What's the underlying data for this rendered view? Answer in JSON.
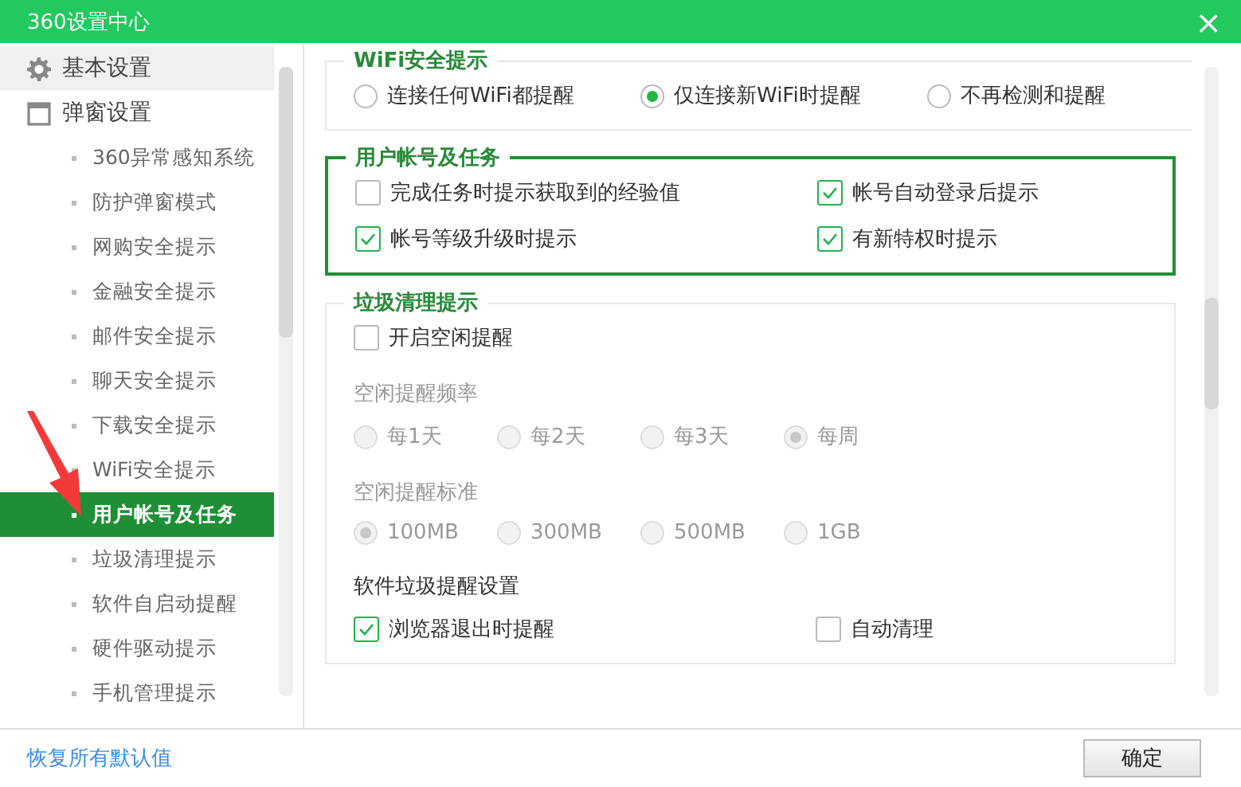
{
  "window": {
    "title": "360设置中心",
    "close": "×"
  },
  "sidebar": {
    "items": [
      {
        "label": "基本设置",
        "highlighted": true
      },
      {
        "label": "弹窗设置",
        "highlighted": false,
        "children": [
          {
            "label": "360异常感知系统",
            "selected": false
          },
          {
            "label": "防护弹窗模式",
            "selected": false
          },
          {
            "label": "网购安全提示",
            "selected": false
          },
          {
            "label": "金融安全提示",
            "selected": false
          },
          {
            "label": "邮件安全提示",
            "selected": false
          },
          {
            "label": "聊天安全提示",
            "selected": false
          },
          {
            "label": "下载安全提示",
            "selected": false
          },
          {
            "label": "WiFi安全提示",
            "selected": false
          },
          {
            "label": "用户帐号及任务",
            "selected": true
          },
          {
            "label": "垃圾清理提示",
            "selected": false
          },
          {
            "label": "软件自启动提醒",
            "selected": false
          },
          {
            "label": "硬件驱动提示",
            "selected": false
          },
          {
            "label": "手机管理提示",
            "selected": false
          }
        ]
      }
    ]
  },
  "sections": [
    {
      "title": "WiFi安全提示",
      "highlighted": false,
      "rows": [
        {
          "kind": "radios",
          "items": [
            {
              "label": "连接任何WiFi都提醒",
              "selected": false,
              "disabled": false
            },
            {
              "label": "仅连接新WiFi时提醒",
              "selected": true,
              "disabled": false
            },
            {
              "label": "不再检测和提醒",
              "selected": false,
              "disabled": false
            }
          ]
        }
      ]
    },
    {
      "title": "用户帐号及任务",
      "highlighted": true,
      "rows": [
        {
          "kind": "checks",
          "items": [
            {
              "label": "完成任务时提示获取到的经验值",
              "checked": false
            },
            {
              "label": "帐号自动登录后提示",
              "checked": true
            },
            {
              "label": "帐号等级升级时提示",
              "checked": true
            },
            {
              "label": "有新特权时提示",
              "checked": true
            }
          ]
        }
      ]
    },
    {
      "title": "垃圾清理提示",
      "highlighted": false,
      "rows": [
        {
          "kind": "checks",
          "items": [
            {
              "label": "开启空闲提醒",
              "checked": false
            }
          ]
        },
        {
          "kind": "label",
          "label": "空闲提醒频率",
          "disabled": true
        },
        {
          "kind": "radios",
          "items": [
            {
              "label": "每1天",
              "selected": false,
              "disabled": true
            },
            {
              "label": "每2天",
              "selected": false,
              "disabled": true
            },
            {
              "label": "每3天",
              "selected": false,
              "disabled": true
            },
            {
              "label": "每周",
              "selected": true,
              "disabled": true
            }
          ]
        },
        {
          "kind": "label",
          "label": "空闲提醒标准",
          "disabled": true
        },
        {
          "kind": "radios",
          "items": [
            {
              "label": "100MB",
              "selected": true,
              "disabled": true
            },
            {
              "label": "300MB",
              "selected": false,
              "disabled": true
            },
            {
              "label": "500MB",
              "selected": false,
              "disabled": true
            },
            {
              "label": "1GB",
              "selected": false,
              "disabled": true
            }
          ]
        },
        {
          "kind": "label",
          "label": "软件垃圾提醒设置",
          "disabled": false
        },
        {
          "kind": "checks",
          "items": [
            {
              "label": "浏览器退出时提醒",
              "checked": true
            },
            {
              "label": "自动清理",
              "checked": false
            }
          ]
        }
      ]
    }
  ],
  "footer": {
    "link": "恢复所有默认值",
    "button": "确定"
  }
}
